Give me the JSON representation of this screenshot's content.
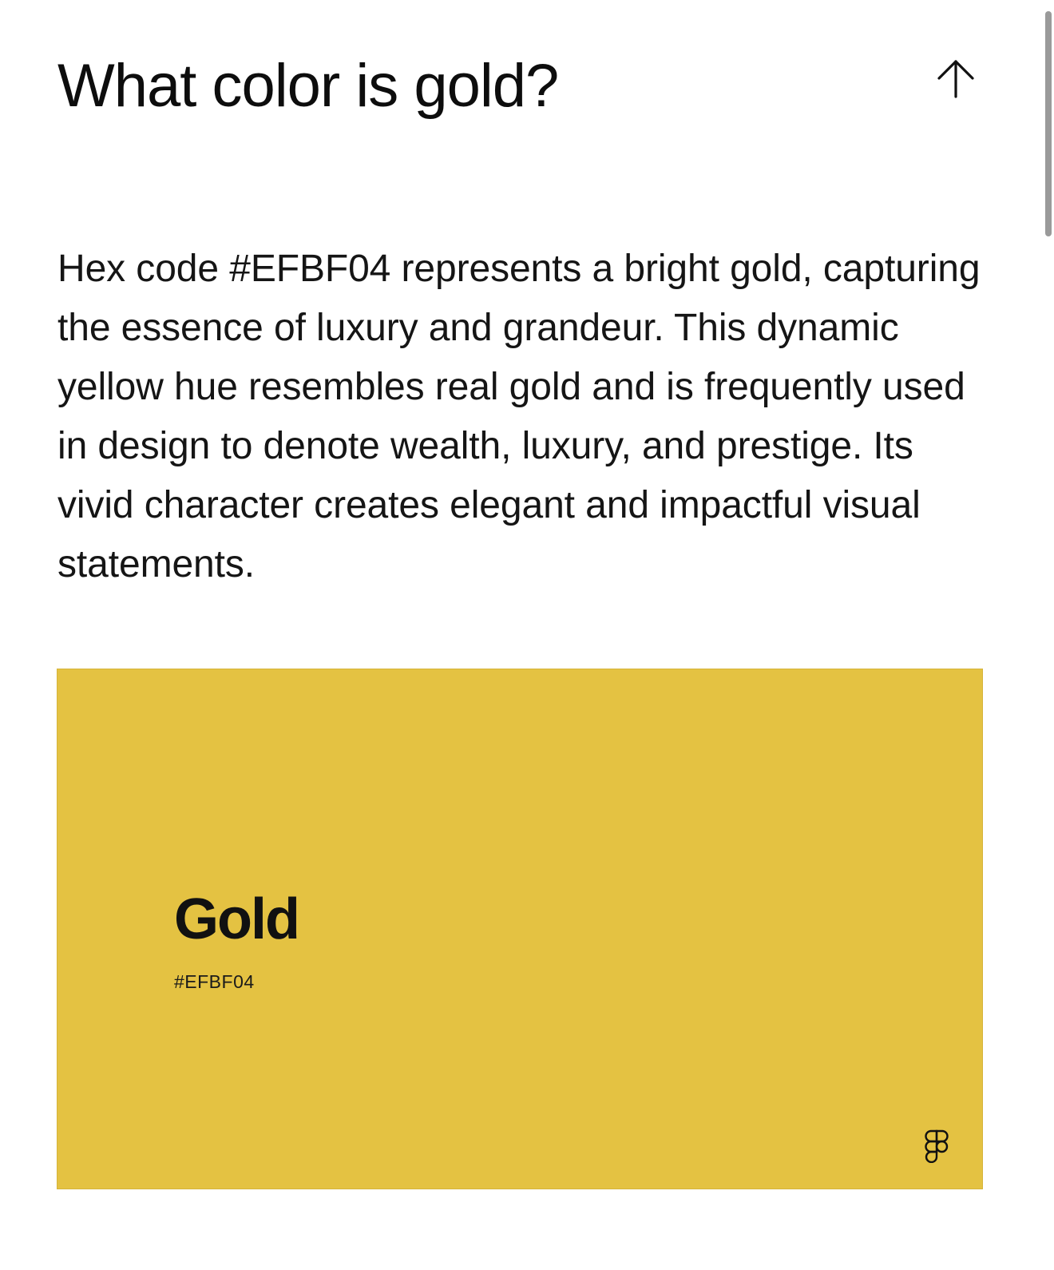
{
  "article": {
    "title": "What color is gold?",
    "description": "Hex code #EFBF04 represents a bright gold, capturing the essence of luxury and grandeur. This dynamic yellow hue resembles real gold and is frequently used in design to denote wealth, luxury, and prestige. Its vivid character creates elegant and impactful visual statements."
  },
  "swatch": {
    "name": "Gold",
    "hex": "#EFBF04",
    "rendered_color": "#E4C242"
  },
  "icons": {
    "scroll_top": "arrow-up-icon",
    "brand": "figma-icon"
  },
  "colors": {
    "text": "#111111",
    "background": "#FFFFFF",
    "scrollbar_thumb": "#9A9A9A"
  }
}
